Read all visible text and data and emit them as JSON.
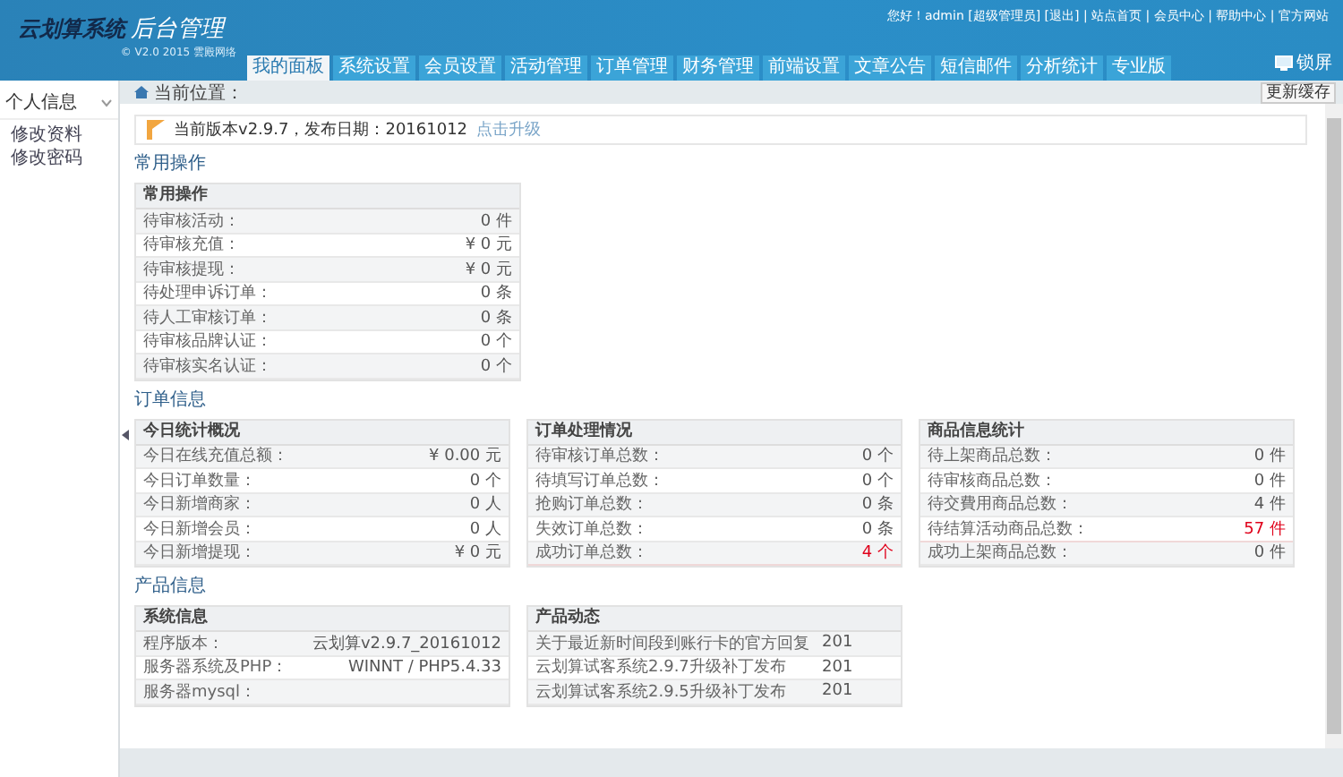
{
  "header": {
    "logo_title": "云划算系统",
    "logo_suffix": "后台管理",
    "subtitle": "© V2.0 2015 雲殿网络",
    "user_links": [
      "您好！admin [超级管理员] [退出] | 站点首页 | 会员中心 | 帮助中心 | 官方网站"
    ],
    "lock_label": "锁屏"
  },
  "nav": {
    "tabs": [
      {
        "label": "我的面板",
        "selected": true
      },
      {
        "label": "系统设置",
        "selected": false
      },
      {
        "label": "会员设置",
        "selected": false
      },
      {
        "label": "活动管理",
        "selected": false
      },
      {
        "label": "订单管理",
        "selected": false
      },
      {
        "label": "财务管理",
        "selected": false
      },
      {
        "label": "前端设置",
        "selected": false
      },
      {
        "label": "文章公告",
        "selected": false
      },
      {
        "label": "短信邮件",
        "selected": false
      },
      {
        "label": "分析统计",
        "selected": false
      },
      {
        "label": "专业版",
        "selected": false
      }
    ]
  },
  "sidebar": {
    "group": "个人信息",
    "expanded": true,
    "items": [
      "修改资料",
      "修改密码"
    ]
  },
  "breadcrumb": "当前位置：",
  "refresh_button": "更新缓存",
  "notice": {
    "text": "当前版本v2.9.7，发布日期：20161012",
    "link": "点击升级"
  },
  "sections": [
    {
      "title": "常用操作",
      "tables": [
        {
          "kind": "stat",
          "title": "常用操作",
          "rows": [
            {
              "label": "待审核活动：",
              "value": "0 件",
              "alert": false
            },
            {
              "label": "待审核充值：",
              "value": "¥ 0 元",
              "alert": false
            },
            {
              "label": "待审核提现：",
              "value": "¥ 0 元",
              "alert": false
            },
            {
              "label": "待处理申诉订单：",
              "value": "0 条",
              "alert": false
            },
            {
              "label": "待人工审核订单：",
              "value": "0 条",
              "alert": false
            },
            {
              "label": "待审核品牌认证：",
              "value": "0 个",
              "alert": false
            },
            {
              "label": "待审核实名认证：",
              "value": "0 个",
              "alert": false
            }
          ]
        }
      ]
    },
    {
      "title": "订单信息",
      "tables": [
        {
          "kind": "stat",
          "title": "今日统计概况",
          "rows": [
            {
              "label": "今日在线充值总额：",
              "value": "¥ 0.00 元",
              "alert": false
            },
            {
              "label": "今日订单数量：",
              "value": "0 个",
              "alert": false
            },
            {
              "label": "今日新增商家：",
              "value": "0 人",
              "alert": false
            },
            {
              "label": "今日新增会员：",
              "value": "0 人",
              "alert": false
            },
            {
              "label": "今日新增提现：",
              "value": "¥ 0 元",
              "alert": false
            }
          ]
        },
        {
          "kind": "stat",
          "title": "订单处理情况",
          "rows": [
            {
              "label": "待审核订单总数：",
              "value": "0 个",
              "alert": false
            },
            {
              "label": "待填写订单总数：",
              "value": "0 个",
              "alert": false
            },
            {
              "label": "抢购订单总数：",
              "value": "0 条",
              "alert": false
            },
            {
              "label": "失效订单总数：",
              "value": "0 条",
              "alert": false
            },
            {
              "label": "成功订单总数：",
              "value": "4 个",
              "alert": true
            }
          ]
        },
        {
          "kind": "stat",
          "title": "商品信息统计",
          "rows": [
            {
              "label": "待上架商品总数：",
              "value": "0 件",
              "alert": false
            },
            {
              "label": "待审核商品总数：",
              "value": "0 件",
              "alert": false
            },
            {
              "label": "待交費用商品总数：",
              "value": "4 件",
              "alert": false
            },
            {
              "label": "待结算活动商品总数：",
              "value": "57 件",
              "alert": true
            },
            {
              "label": "成功上架商品总数：",
              "value": "0 件",
              "alert": false
            }
          ]
        }
      ]
    },
    {
      "title": "产品信息",
      "tables": [
        {
          "kind": "stat",
          "title": "系统信息",
          "rows": [
            {
              "label": "程序版本：",
              "value": "云划算v2.9.7_20161012",
              "alert": false
            },
            {
              "label": "服务器系统及PHP：",
              "value": "WINNT / PHP5.4.33",
              "alert": false
            },
            {
              "label": "服务器mysql：",
              "value": "",
              "alert": false
            }
          ]
        },
        {
          "kind": "news",
          "title": "产品动态",
          "rows": [
            {
              "label": "关于最近新时间段到账行卡的官方回复",
              "value": "201",
              "alert": false
            },
            {
              "label": "云划算试客系统2.9.7升级补丁发布",
              "value": "201",
              "alert": false
            },
            {
              "label": "云划算试客系统2.9.5升级补丁发布",
              "value": "201",
              "alert": false
            }
          ]
        }
      ]
    }
  ]
}
